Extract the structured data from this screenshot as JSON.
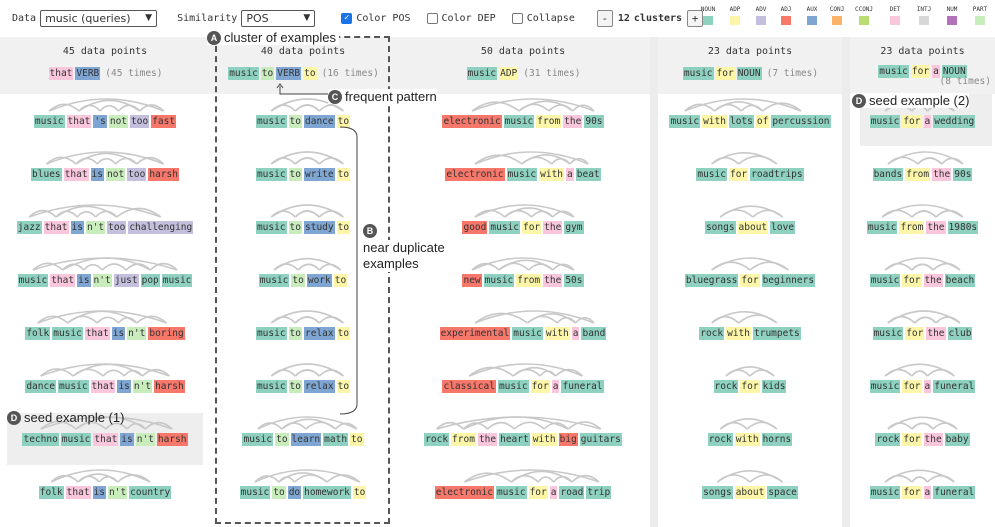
{
  "toolbar": {
    "data_label": "Data",
    "data_value": "music (queries)",
    "similarity_label": "Similarity",
    "similarity_value": "POS",
    "color_pos_label": "Color POS",
    "color_dep_label": "Color DEP",
    "collapse_label": "Collapse",
    "minus": "-",
    "plus": "+",
    "clusters_count": "12",
    "clusters_label": "clusters",
    "color_pos_checked": true,
    "color_dep_checked": false,
    "collapse_checked": false
  },
  "legend": [
    {
      "tag": "NOUN",
      "color": "#8fd1c0"
    },
    {
      "tag": "ADP",
      "color": "#fdf6a8"
    },
    {
      "tag": "ADV",
      "color": "#c3bfdc"
    },
    {
      "tag": "ADJ",
      "color": "#f7776b"
    },
    {
      "tag": "AUX",
      "color": "#7fa6d2"
    },
    {
      "tag": "CONJ",
      "color": "#fbb36a"
    },
    {
      "tag": "CCONJ",
      "color": "#b9dd72"
    },
    {
      "tag": "DET",
      "color": "#f9c6dc"
    },
    {
      "tag": "INTJ",
      "color": "#d7d7d7"
    },
    {
      "tag": "NUM",
      "color": "#b472ba"
    },
    {
      "tag": "PART",
      "color": "#c8ecbc"
    }
  ],
  "columns": [
    {
      "count": "45 data points",
      "pattern": [
        [
          "that",
          "DET"
        ],
        [
          "VERB",
          "AUX"
        ]
      ],
      "times": "(45 times)",
      "rows": [
        [
          [
            "music",
            "NOUN"
          ],
          [
            "that",
            "DET"
          ],
          [
            "'s",
            "AUX"
          ],
          [
            "not",
            "PART"
          ],
          [
            "too",
            "ADV"
          ],
          [
            "fast",
            "ADJ"
          ]
        ],
        [
          [
            "blues",
            "NOUN"
          ],
          [
            "that",
            "DET"
          ],
          [
            "is",
            "AUX"
          ],
          [
            "not",
            "PART"
          ],
          [
            "too",
            "ADV"
          ],
          [
            "harsh",
            "ADJ"
          ]
        ],
        [
          [
            "jazz",
            "NOUN"
          ],
          [
            "that",
            "DET"
          ],
          [
            "is",
            "AUX"
          ],
          [
            "n't",
            "PART"
          ],
          [
            "too",
            "ADV"
          ],
          [
            "challenging",
            "ADV"
          ]
        ],
        [
          [
            "music",
            "NOUN"
          ],
          [
            "that",
            "DET"
          ],
          [
            "is",
            "AUX"
          ],
          [
            "n't",
            "PART"
          ],
          [
            "just",
            "ADV"
          ],
          [
            "pop",
            "NOUN"
          ],
          [
            "music",
            "NOUN"
          ]
        ],
        [
          [
            "folk",
            "NOUN"
          ],
          [
            "music",
            "NOUN"
          ],
          [
            "that",
            "DET"
          ],
          [
            "is",
            "AUX"
          ],
          [
            "n't",
            "PART"
          ],
          [
            "boring",
            "ADJ"
          ]
        ],
        [
          [
            "dance",
            "NOUN"
          ],
          [
            "music",
            "NOUN"
          ],
          [
            "that",
            "DET"
          ],
          [
            "is",
            "AUX"
          ],
          [
            "n't",
            "PART"
          ],
          [
            "harsh",
            "ADJ"
          ]
        ],
        [
          [
            "techno",
            "NOUN"
          ],
          [
            "music",
            "NOUN"
          ],
          [
            "that",
            "DET"
          ],
          [
            "is",
            "AUX"
          ],
          [
            "n't",
            "PART"
          ],
          [
            "harsh",
            "ADJ"
          ]
        ],
        [
          [
            "folk",
            "NOUN"
          ],
          [
            "that",
            "DET"
          ],
          [
            "is",
            "AUX"
          ],
          [
            "n't",
            "PART"
          ],
          [
            "country",
            "NOUN"
          ]
        ]
      ]
    },
    {
      "count": "40 data points",
      "pattern": [
        [
          "music",
          "NOUN"
        ],
        [
          "to",
          "PART"
        ],
        [
          "VERB",
          "AUX"
        ],
        [
          "to",
          "ADP"
        ]
      ],
      "times": "(16 times)",
      "rows": [
        [
          [
            "music",
            "NOUN"
          ],
          [
            "to",
            "PART"
          ],
          [
            "dance",
            "AUX"
          ],
          [
            "to",
            "ADP"
          ]
        ],
        [
          [
            "music",
            "NOUN"
          ],
          [
            "to",
            "PART"
          ],
          [
            "write",
            "AUX"
          ],
          [
            "to",
            "ADP"
          ]
        ],
        [
          [
            "music",
            "NOUN"
          ],
          [
            "to",
            "PART"
          ],
          [
            "study",
            "AUX"
          ],
          [
            "to",
            "ADP"
          ]
        ],
        [
          [
            "music",
            "NOUN"
          ],
          [
            "to",
            "PART"
          ],
          [
            "work",
            "AUX"
          ],
          [
            "to",
            "ADP"
          ]
        ],
        [
          [
            "music",
            "NOUN"
          ],
          [
            "to",
            "PART"
          ],
          [
            "relax",
            "AUX"
          ],
          [
            "to",
            "ADP"
          ]
        ],
        [
          [
            "music",
            "NOUN"
          ],
          [
            "to",
            "PART"
          ],
          [
            "relax",
            "AUX"
          ],
          [
            "to",
            "ADP"
          ]
        ],
        [
          [
            "music",
            "NOUN"
          ],
          [
            "to",
            "PART"
          ],
          [
            "learn",
            "AUX"
          ],
          [
            "math",
            "NOUN"
          ],
          [
            "to",
            "ADP"
          ]
        ],
        [
          [
            "music",
            "NOUN"
          ],
          [
            "to",
            "PART"
          ],
          [
            "do",
            "AUX"
          ],
          [
            "homework",
            "NOUN"
          ],
          [
            "to",
            "ADP"
          ]
        ]
      ]
    },
    {
      "count": "50 data points",
      "pattern": [
        [
          "music",
          "NOUN"
        ],
        [
          "ADP",
          "ADP"
        ]
      ],
      "times": "(31 times)",
      "rows": [
        [
          [
            "electronic",
            "ADJ"
          ],
          [
            "music",
            "NOUN"
          ],
          [
            "from",
            "ADP"
          ],
          [
            "the",
            "DET"
          ],
          [
            "90s",
            "NOUN"
          ]
        ],
        [
          [
            "electronic",
            "ADJ"
          ],
          [
            "music",
            "NOUN"
          ],
          [
            "with",
            "ADP"
          ],
          [
            "a",
            "DET"
          ],
          [
            "beat",
            "NOUN"
          ]
        ],
        [
          [
            "good",
            "ADJ"
          ],
          [
            "music",
            "NOUN"
          ],
          [
            "for",
            "ADP"
          ],
          [
            "the",
            "DET"
          ],
          [
            "gym",
            "NOUN"
          ]
        ],
        [
          [
            "new",
            "ADJ"
          ],
          [
            "music",
            "NOUN"
          ],
          [
            "from",
            "ADP"
          ],
          [
            "the",
            "DET"
          ],
          [
            "50s",
            "NOUN"
          ]
        ],
        [
          [
            "experimental",
            "ADJ"
          ],
          [
            "music",
            "NOUN"
          ],
          [
            "with",
            "ADP"
          ],
          [
            "a",
            "DET"
          ],
          [
            "band",
            "NOUN"
          ]
        ],
        [
          [
            "classical",
            "ADJ"
          ],
          [
            "music",
            "NOUN"
          ],
          [
            "for",
            "ADP"
          ],
          [
            "a",
            "DET"
          ],
          [
            "funeral",
            "NOUN"
          ]
        ],
        [
          [
            "rock",
            "NOUN"
          ],
          [
            "from",
            "ADP"
          ],
          [
            "the",
            "DET"
          ],
          [
            "heart",
            "NOUN"
          ],
          [
            "with",
            "ADP"
          ],
          [
            "big",
            "ADJ"
          ],
          [
            "guitars",
            "NOUN"
          ]
        ],
        [
          [
            "electronic",
            "ADJ"
          ],
          [
            "music",
            "NOUN"
          ],
          [
            "for",
            "ADP"
          ],
          [
            "a",
            "DET"
          ],
          [
            "road",
            "NOUN"
          ],
          [
            "trip",
            "NOUN"
          ]
        ]
      ]
    },
    {
      "count": "23 data points",
      "pattern": [
        [
          "music",
          "NOUN"
        ],
        [
          "for",
          "ADP"
        ],
        [
          "NOUN",
          "NOUN"
        ]
      ],
      "times": "(7 times)",
      "rows": [
        [
          [
            "music",
            "NOUN"
          ],
          [
            "with",
            "ADP"
          ],
          [
            "lots",
            "NOUN"
          ],
          [
            "of",
            "ADP"
          ],
          [
            "percussion",
            "NOUN"
          ]
        ],
        [
          [
            "music",
            "NOUN"
          ],
          [
            "for",
            "ADP"
          ],
          [
            "roadtrips",
            "NOUN"
          ]
        ],
        [
          [
            "songs",
            "NOUN"
          ],
          [
            "about",
            "ADP"
          ],
          [
            "love",
            "NOUN"
          ]
        ],
        [
          [
            "bluegrass",
            "NOUN"
          ],
          [
            "for",
            "ADP"
          ],
          [
            "beginners",
            "NOUN"
          ]
        ],
        [
          [
            "rock",
            "NOUN"
          ],
          [
            "with",
            "ADP"
          ],
          [
            "trumpets",
            "NOUN"
          ]
        ],
        [
          [
            "rock",
            "NOUN"
          ],
          [
            "for",
            "ADP"
          ],
          [
            "kids",
            "NOUN"
          ]
        ],
        [
          [
            "rock",
            "NOUN"
          ],
          [
            "with",
            "ADP"
          ],
          [
            "horns",
            "NOUN"
          ]
        ],
        [
          [
            "songs",
            "NOUN"
          ],
          [
            "about",
            "ADP"
          ],
          [
            "space",
            "NOUN"
          ]
        ]
      ]
    },
    {
      "count": "23 data points",
      "pattern": [
        [
          "music",
          "NOUN"
        ],
        [
          "for",
          "ADP"
        ],
        [
          "a",
          "DET"
        ],
        [
          "NOUN",
          "NOUN"
        ]
      ],
      "times": "(8 times)",
      "rows": [
        [
          [
            "music",
            "NOUN"
          ],
          [
            "for",
            "ADP"
          ],
          [
            "a",
            "DET"
          ],
          [
            "wedding",
            "NOUN"
          ]
        ],
        [
          [
            "bands",
            "NOUN"
          ],
          [
            "from",
            "ADP"
          ],
          [
            "the",
            "DET"
          ],
          [
            "90s",
            "NOUN"
          ]
        ],
        [
          [
            "music",
            "NOUN"
          ],
          [
            "from",
            "ADP"
          ],
          [
            "the",
            "DET"
          ],
          [
            "1980s",
            "NOUN"
          ]
        ],
        [
          [
            "music",
            "NOUN"
          ],
          [
            "for",
            "ADP"
          ],
          [
            "the",
            "DET"
          ],
          [
            "beach",
            "NOUN"
          ]
        ],
        [
          [
            "music",
            "NOUN"
          ],
          [
            "for",
            "ADP"
          ],
          [
            "the",
            "DET"
          ],
          [
            "club",
            "NOUN"
          ]
        ],
        [
          [
            "music",
            "NOUN"
          ],
          [
            "for",
            "ADP"
          ],
          [
            "a",
            "DET"
          ],
          [
            "funeral",
            "NOUN"
          ]
        ],
        [
          [
            "rock",
            "NOUN"
          ],
          [
            "for",
            "ADP"
          ],
          [
            "the",
            "DET"
          ],
          [
            "baby",
            "NOUN"
          ]
        ],
        [
          [
            "music",
            "NOUN"
          ],
          [
            "for",
            "ADP"
          ],
          [
            "a",
            "DET"
          ],
          [
            "funeral",
            "NOUN"
          ]
        ]
      ]
    }
  ],
  "annotations": {
    "a_letter": "A",
    "a_text": "cluster of examples",
    "b_letter": "B",
    "b_text_1": "near duplicate",
    "b_text_2": "examples",
    "c_letter": "C",
    "c_text": "frequent pattern",
    "d1_letter": "D",
    "d1_text": "seed example (1)",
    "d2_letter": "D",
    "d2_text": "seed example (2)"
  }
}
